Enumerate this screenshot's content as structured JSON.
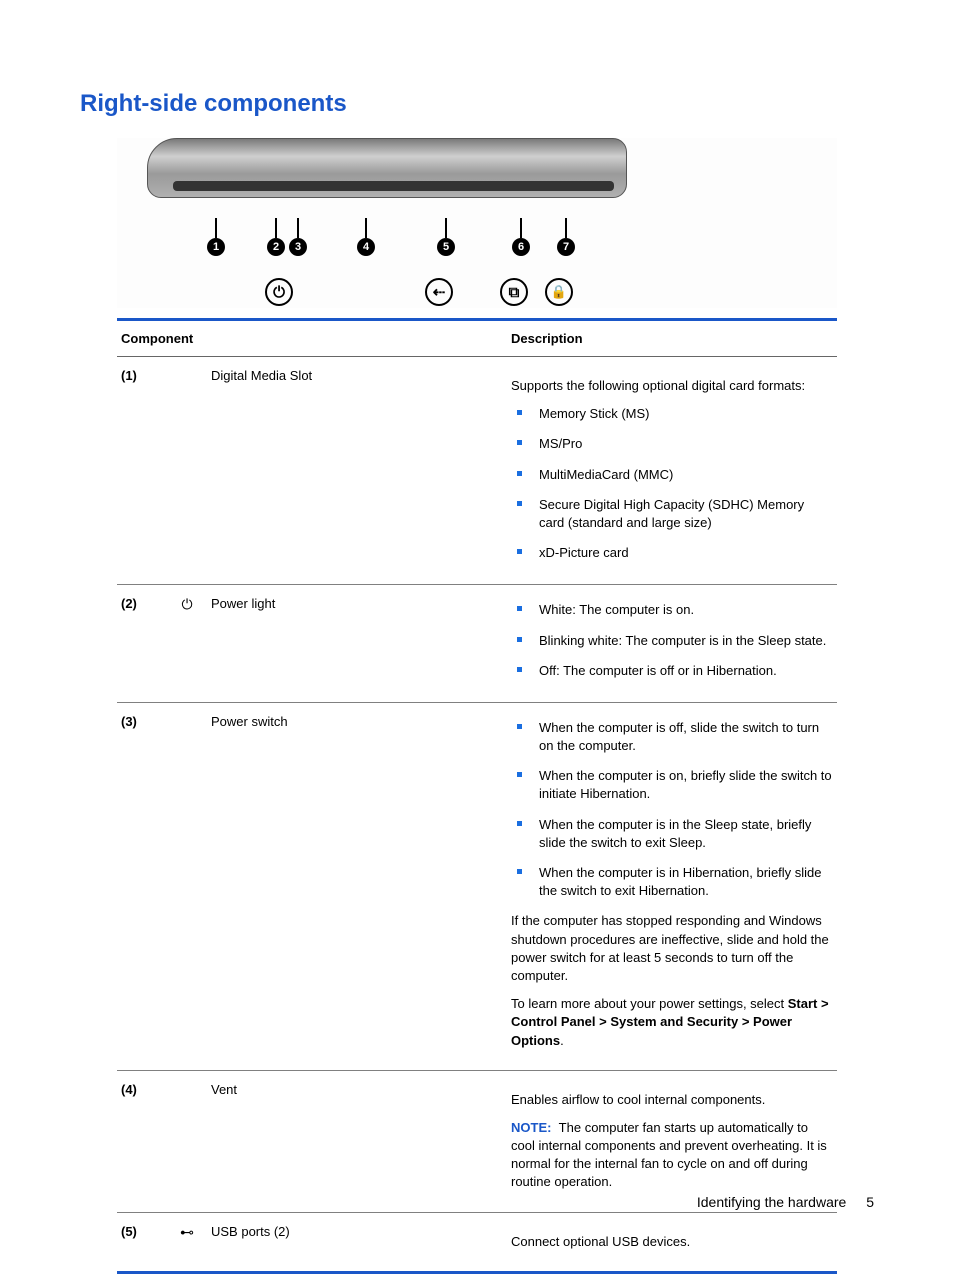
{
  "section_title": "Right-side components",
  "callouts": [
    "1",
    "2",
    "3",
    "4",
    "5",
    "6",
    "7"
  ],
  "icon_glyphs": {
    "power": "⏻",
    "usb": "⇠",
    "rj45": "⧉",
    "lock": "🔒"
  },
  "table": {
    "headers": {
      "component": "Component",
      "description": "Description"
    },
    "rows": [
      {
        "num": "(1)",
        "icon": "",
        "icon_name": "none",
        "name": "Digital Media Slot",
        "desc_intro": "Supports the following optional digital card formats:",
        "bullets": [
          "Memory Stick (MS)",
          "MS/Pro",
          "MultiMediaCard (MMC)",
          "Secure Digital High Capacity (SDHC) Memory card (standard and large size)",
          "xD-Picture card"
        ]
      },
      {
        "num": "(2)",
        "icon": "⏻",
        "icon_name": "power-icon",
        "name": "Power light",
        "bullets": [
          "White: The computer is on.",
          "Blinking white: The computer is in the Sleep state.",
          "Off: The computer is off or in Hibernation."
        ]
      },
      {
        "num": "(3)",
        "icon": "",
        "icon_name": "none",
        "name": "Power switch",
        "bullets": [
          "When the computer is off, slide the switch to turn on the computer.",
          "When the computer is on, briefly slide the switch to initiate Hibernation.",
          "When the computer is in the Sleep state, briefly slide the switch to exit Sleep.",
          "When the computer is in Hibernation, briefly slide the switch to exit Hibernation."
        ],
        "paras": [
          "If the computer has stopped responding and Windows shutdown procedures are ineffective, slide and hold the power switch for at least 5 seconds to turn off the computer."
        ],
        "rich_para_pre": "To learn more about your power settings, select ",
        "rich_para_bold": "Start > Control Panel > System and Security > Power Options",
        "rich_para_post": "."
      },
      {
        "num": "(4)",
        "icon": "",
        "icon_name": "none",
        "name": "Vent",
        "desc_intro": "Enables airflow to cool internal components.",
        "note_label": "NOTE:",
        "note_text": "The computer fan starts up automatically to cool internal components and prevent overheating. It is normal for the internal fan to cycle on and off during routine operation."
      },
      {
        "num": "(5)",
        "icon": "⊷",
        "icon_name": "usb-icon",
        "name": "USB ports (2)",
        "desc_intro": "Connect optional USB devices."
      }
    ]
  },
  "footer": {
    "section": "Identifying the hardware",
    "page": "5"
  }
}
